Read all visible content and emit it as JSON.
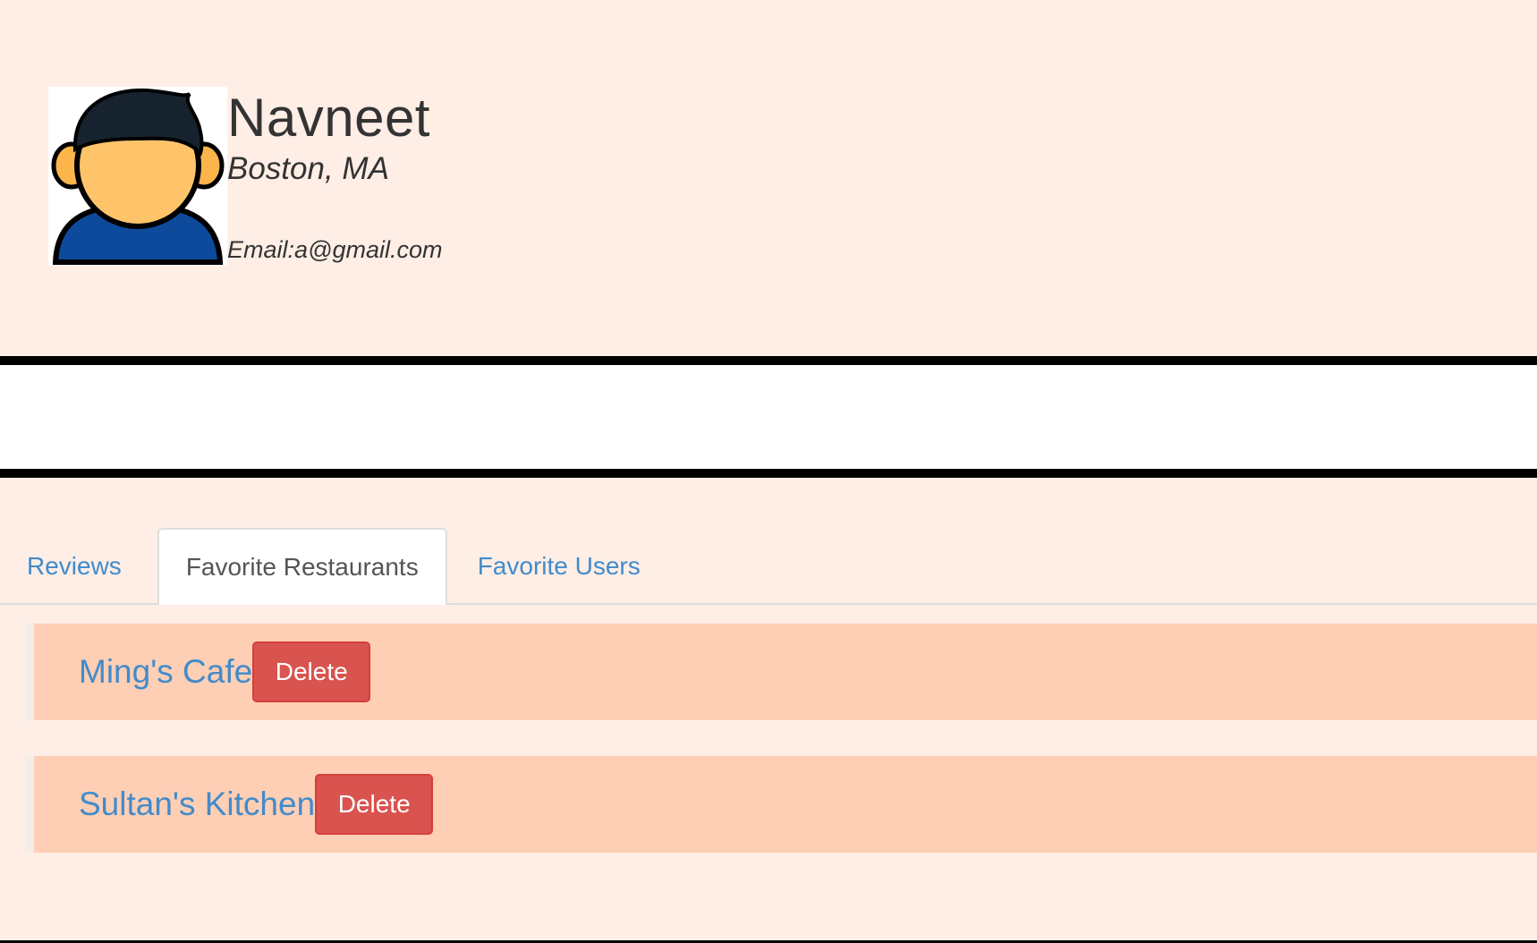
{
  "profile": {
    "name": "Navneet",
    "location": "Boston, MA",
    "email": "Email:a@gmail.com"
  },
  "tabs": [
    {
      "label": "Reviews",
      "active": false
    },
    {
      "label": "Favorite Restaurants",
      "active": true
    },
    {
      "label": "Favorite Users",
      "active": false
    }
  ],
  "favorites": [
    {
      "name": "Ming's Cafe",
      "action": "Delete"
    },
    {
      "name": "Sultan's Kitchen",
      "action": "Delete"
    }
  ],
  "colors": {
    "page_background": "#ffeee6",
    "row_background": "#fecfb5",
    "link": "#428bca",
    "danger": "#d9534f"
  }
}
